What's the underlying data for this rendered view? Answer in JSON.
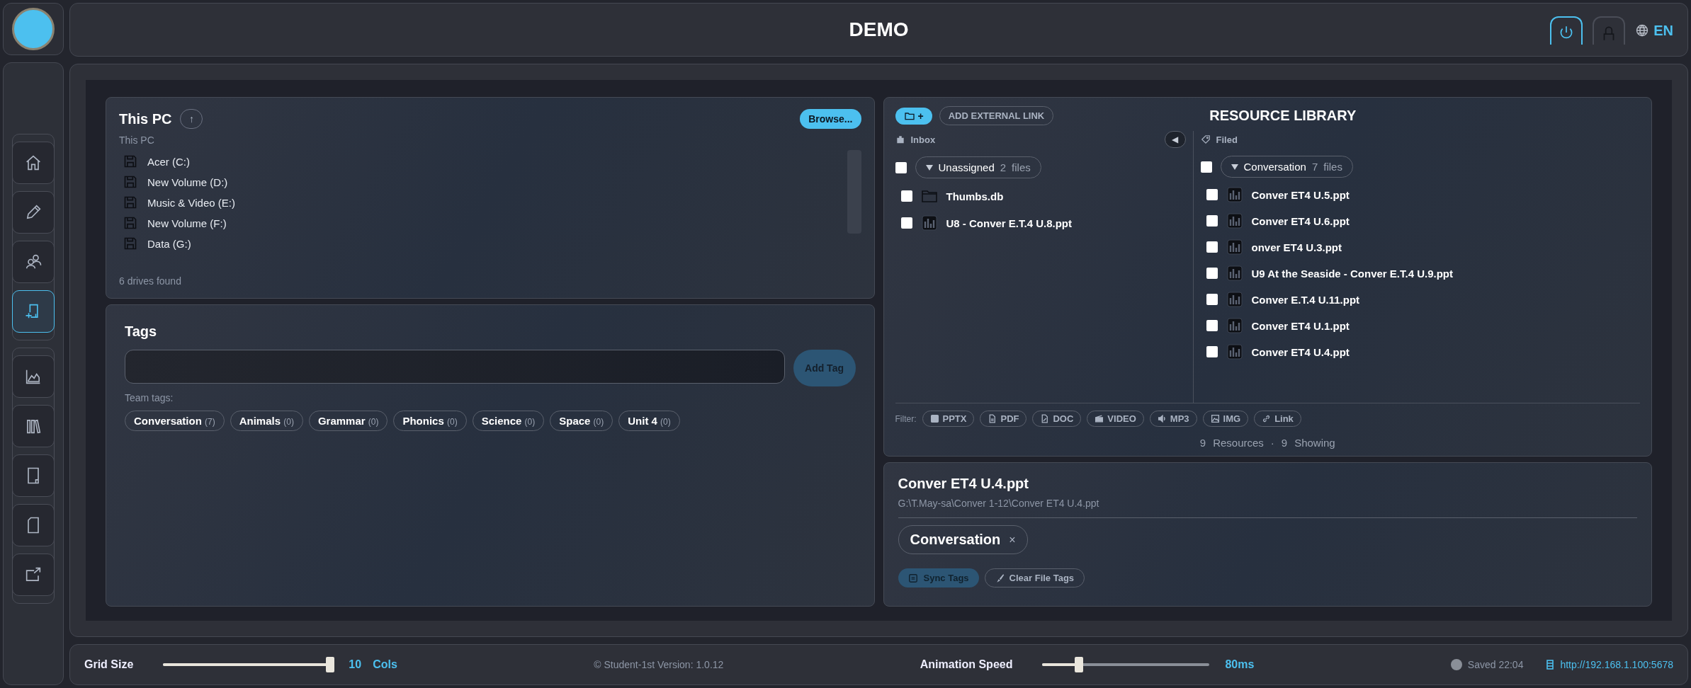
{
  "header": {
    "title": "DEMO",
    "power": {
      "on": true
    },
    "lock": {
      "on": false
    },
    "language": "EN"
  },
  "sidebar": {
    "groups": [
      {
        "items": [
          {
            "kind": "home",
            "selected": false
          },
          {
            "kind": "pencil",
            "selected": false
          },
          {
            "kind": "people",
            "selected": false
          },
          {
            "kind": "add-doc",
            "selected": true
          }
        ]
      },
      {
        "items": [
          {
            "kind": "chart",
            "selected": false
          },
          {
            "kind": "library",
            "selected": false
          },
          {
            "kind": "tablet",
            "selected": false
          },
          {
            "kind": "page",
            "selected": false
          },
          {
            "kind": "export",
            "selected": false
          }
        ]
      }
    ]
  },
  "drive_browser": {
    "title": "This PC",
    "up_button": "↑",
    "browse_button": "Browse...",
    "path": "This PC",
    "drives": [
      "Acer (C:)",
      "New Volume (D:)",
      "Music & Video (E:)",
      "New Volume (F:)",
      "Data (G:)"
    ],
    "status": "6 drives found"
  },
  "tags": {
    "title": "Tags",
    "add_button": "Add Tag",
    "team_label": "Team tags:",
    "team_tags": [
      {
        "name": "Conversation",
        "count": "(7)"
      },
      {
        "name": "Animals",
        "count": "(0)"
      },
      {
        "name": "Grammar",
        "count": "(0)"
      },
      {
        "name": "Phonics",
        "count": "(0)"
      },
      {
        "name": "Science",
        "count": "(0)"
      },
      {
        "name": "Space",
        "count": "(0)"
      },
      {
        "name": "Unit 4",
        "count": "(0)"
      }
    ]
  },
  "library": {
    "title": "RESOURCE LIBRARY",
    "add_folder_button": "+",
    "external_link_button": "ADD EXTERNAL LINK",
    "collapse_button": "◀",
    "inbox": {
      "label": "Inbox",
      "group": {
        "name": "Unassigned",
        "count": "2",
        "unit": "files",
        "checked": false
      },
      "files": [
        {
          "name": "Thumbs.db",
          "kind": "folder",
          "checked": false
        },
        {
          "name": "U8 - Conver E.T.4 U.8.ppt",
          "kind": "ppt",
          "checked": false
        }
      ]
    },
    "filed": {
      "label": "Filed",
      "group": {
        "name": "Conversation",
        "count": "7",
        "unit": "files",
        "checked": false
      },
      "files": [
        {
          "name": "Conver ET4 U.5.ppt",
          "kind": "ppt",
          "checked": false
        },
        {
          "name": "Conver ET4 U.6.ppt",
          "kind": "ppt",
          "checked": false
        },
        {
          "name": "onver ET4 U.3.ppt",
          "kind": "ppt",
          "checked": false
        },
        {
          "name": "U9 At the Seaside - Conver E.T.4 U.9.ppt",
          "kind": "ppt",
          "checked": false
        },
        {
          "name": "Conver E.T.4 U.11.ppt",
          "kind": "ppt",
          "checked": false
        },
        {
          "name": "Conver ET4 U.1.ppt",
          "kind": "ppt",
          "checked": false
        },
        {
          "name": "Conver ET4 U.4.ppt",
          "kind": "ppt",
          "checked": false
        }
      ]
    },
    "filter_label": "Filter:",
    "filters": [
      {
        "label": "PPTX",
        "kind": "pptx"
      },
      {
        "label": "PDF",
        "kind": "pdf"
      },
      {
        "label": "DOC",
        "kind": "doc"
      },
      {
        "label": "VIDEO",
        "kind": "video"
      },
      {
        "label": "MP3",
        "kind": "audio"
      },
      {
        "label": "IMG",
        "kind": "image"
      },
      {
        "label": "Link",
        "kind": "link"
      }
    ],
    "summary": {
      "total": "9",
      "total_label": "Resources",
      "separator": "·",
      "showing": "9",
      "showing_label": "Showing"
    }
  },
  "details": {
    "title": "Conver ET4 U.4.ppt",
    "path": "G:\\T.May-sa\\Conver 1-12\\Conver ET4 U.4.ppt",
    "tags": [
      {
        "name": "Conversation",
        "remove": "×"
      }
    ],
    "sync_button": "Sync Tags",
    "clear_button": "Clear File Tags"
  },
  "footer": {
    "grid_size": {
      "label": "Grid Size",
      "level": 0.98,
      "value": "10",
      "unit": "Cols"
    },
    "version": "© Student-1st  Version: 1.0.12",
    "animation_speed": {
      "label": "Animation Speed",
      "level": 0.22,
      "value": "80ms"
    },
    "saved": "Saved 22:04",
    "url": "http://192.168.1.100:5678"
  }
}
